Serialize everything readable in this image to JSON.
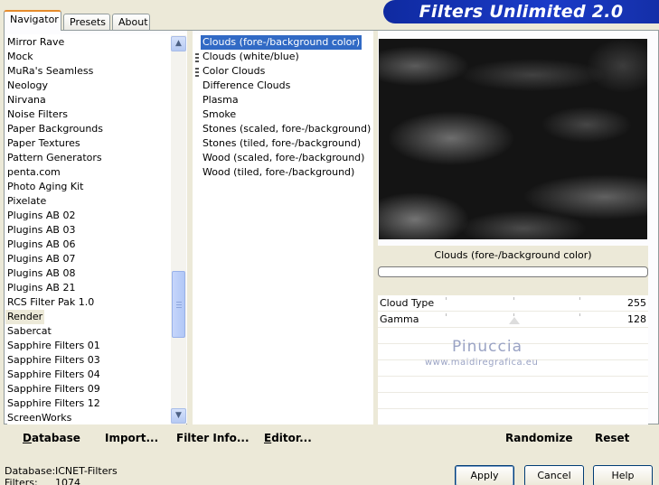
{
  "tabs": [
    {
      "label": "Navigator"
    },
    {
      "label": "Presets"
    },
    {
      "label": "About"
    }
  ],
  "banner": {
    "title": "Filters Unlimited 2.0"
  },
  "categories": {
    "items": [
      "Mirror Rave",
      "Mock",
      "MuRa's Seamless",
      "Neology",
      "Nirvana",
      "Noise Filters",
      "Paper Backgrounds",
      "Paper Textures",
      "Pattern Generators",
      "penta.com",
      "Photo Aging Kit",
      "Pixelate",
      "Plugins AB 02",
      "Plugins AB 03",
      "Plugins AB 06",
      "Plugins AB 07",
      "Plugins AB 08",
      "Plugins AB 21",
      "RCS Filter Pak 1.0",
      "Render",
      "Sabercat",
      "Sapphire Filters 01",
      "Sapphire Filters 03",
      "Sapphire Filters 04",
      "Sapphire Filters 09",
      "Sapphire Filters 12",
      "ScreenWorks"
    ],
    "selected": "Render",
    "scroll_up_icon": "chevron-up-icon",
    "scroll_down_icon": "chevron-down-icon"
  },
  "filters": {
    "items": [
      "Clouds (fore-/background color)",
      "Clouds (white/blue)",
      "Color Clouds",
      "Difference Clouds",
      "Plasma",
      "Smoke",
      "Stones (scaled, fore-/background)",
      "Stones (tiled, fore-/background)",
      "Wood (scaled, fore-/background)",
      "Wood (tiled, fore-/background)"
    ],
    "selected": "Clouds (fore-/background color)",
    "selection_color": "#316ac5"
  },
  "preview": {
    "filter_name": "Clouds (fore-/background color)"
  },
  "params": [
    {
      "label": "Cloud Type",
      "value": "255"
    },
    {
      "label": "Gamma",
      "value": "128"
    }
  ],
  "watermark": {
    "line1": "Pinuccia",
    "line2": "www.maidiregrafica.eu"
  },
  "toolbar": {
    "database": "Database",
    "import": "Import...",
    "filter_info": "Filter Info...",
    "editor": "Editor...",
    "randomize": "Randomize",
    "reset": "Reset"
  },
  "status": {
    "database_label": "Database:",
    "database_value": "ICNET-Filters",
    "filters_label": "Filters:",
    "filters_value": "1074"
  },
  "buttons": {
    "apply": "Apply",
    "cancel": "Cancel",
    "help": "Help"
  },
  "colors": {
    "banner": "#1a3bc8",
    "window_bg": "#ece9d8",
    "active_tab_accent": "#e68b2c"
  }
}
